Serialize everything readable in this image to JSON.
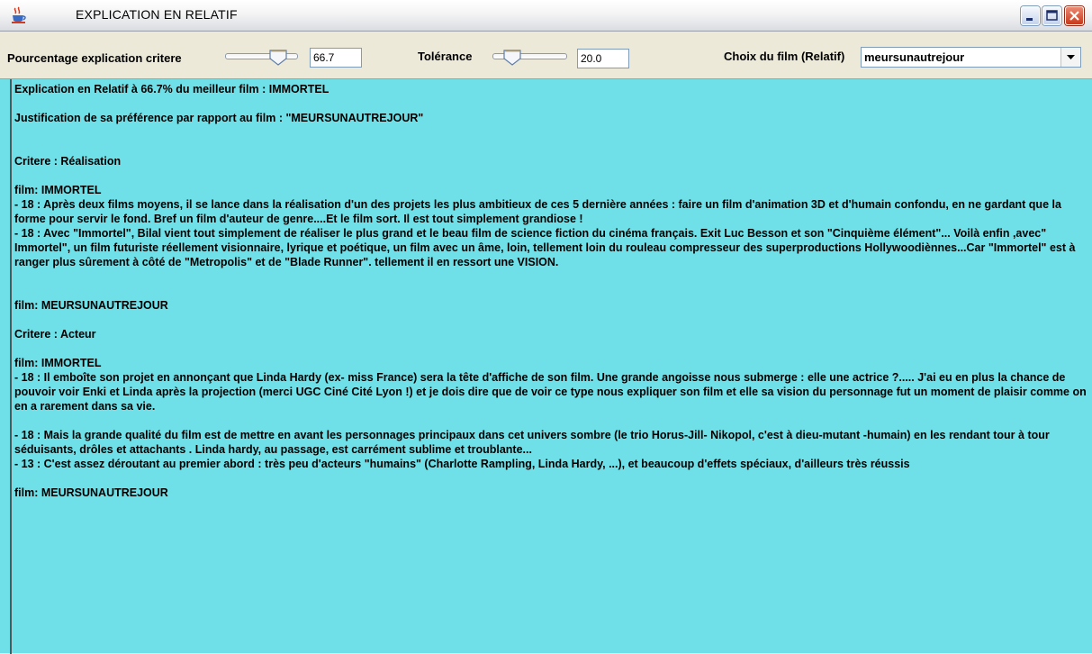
{
  "window": {
    "title": "EXPLICATION EN RELATIF"
  },
  "toolbar": {
    "pourcentage_label": "Pourcentage explication critere",
    "pourcentage_value": "66.7",
    "pourcentage_slider_fraction": 0.667,
    "tolerance_label": "Tolérance",
    "tolerance_value": "20.0",
    "tolerance_slider_fraction": 0.2,
    "choix_label": "Choix du film (Relatif)",
    "choix_selected": "meursunautrejour"
  },
  "content": {
    "background": "#6fe0e8",
    "lines": {
      "l1": "Explication en Relatif à 66.7% du meilleur film : IMMORTEL",
      "l2": "Justification de sa préférence par rapport au film : \"MEURSUNAUTREJOUR\"",
      "l3": "Critere : Réalisation",
      "l4": "film: IMMORTEL",
      "l5": "- 18 : Après deux films moyens, il se lance dans la réalisation d'un des projets les plus ambitieux de ces 5 dernière années : faire un film d'animation 3D et d'humain confondu, en ne gardant que la forme pour servir le fond. Bref un film d'auteur de genre....Et le film sort. Il est tout simplement grandiose !",
      "l6": "- 18 : Avec \"Immortel\", Bilal vient tout simplement de réaliser le plus grand et le beau film de science fiction du cinéma français. Exit Luc Besson et son \"Cinquième élément\"... Voilà enfin ,avec\" Immortel\", un film futuriste réellement visionnaire, lyrique et poétique, un film avec un âme, loin, tellement loin du rouleau compresseur des superproductions Hollywoodiènnes...Car \"Immortel\" est à ranger plus sûrement à côté de \"Metropolis\" et de \"Blade Runner\". tellement il en ressort une VISION.",
      "l7": "film: MEURSUNAUTREJOUR",
      "l8": "Critere : Acteur",
      "l9": "film: IMMORTEL",
      "l10": "- 18 : Il emboîte son projet en annonçant que Linda Hardy (ex- miss France) sera la tête d'affiche de son film. Une grande angoisse nous submerge : elle une actrice ?..... J'ai eu en plus la chance de pouvoir voir Enki et Linda après la projection (merci UGC Ciné Cité Lyon !) et je dois dire que de voir ce type nous expliquer son film et elle sa vision du personnage fut un moment de plaisir comme on en a rarement dans sa vie.",
      "l11": "- 18 : Mais la grande qualité du film est de mettre en avant les personnages principaux dans cet univers sombre (le trio Horus-Jill- Nikopol, c'est à dieu-mutant -humain) en les rendant tour à tour séduisants, drôles et attachants . Linda hardy, au passage, est carrément sublime et troublante...",
      "l12": "- 13 : C'est assez déroutant au premier abord : très peu d'acteurs \"humains\" (Charlotte Rampling, Linda Hardy, ...), et beaucoup d'effets spéciaux, d'ailleurs très réussis",
      "l13": "film: MEURSUNAUTREJOUR"
    }
  }
}
